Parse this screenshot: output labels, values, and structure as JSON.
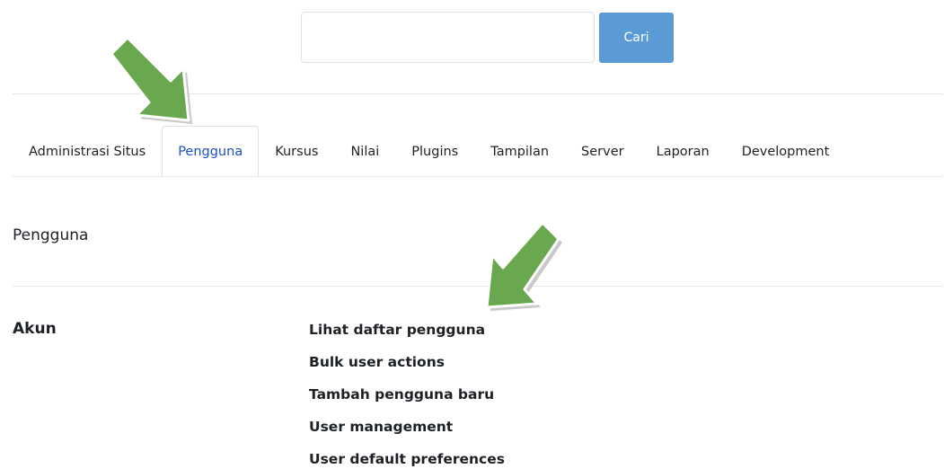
{
  "search": {
    "value": "",
    "placeholder": "",
    "button_label": "Cari"
  },
  "tabs": [
    {
      "label": "Administrasi Situs",
      "active": false
    },
    {
      "label": "Pengguna",
      "active": true
    },
    {
      "label": "Kursus",
      "active": false
    },
    {
      "label": "Nilai",
      "active": false
    },
    {
      "label": "Plugins",
      "active": false
    },
    {
      "label": "Tampilan",
      "active": false
    },
    {
      "label": "Server",
      "active": false
    },
    {
      "label": "Laporan",
      "active": false
    },
    {
      "label": "Development",
      "active": false
    }
  ],
  "section": {
    "title": "Pengguna"
  },
  "category": {
    "title": "Akun",
    "links": [
      "Lihat daftar pengguna",
      "Bulk user actions",
      "Tambah pengguna baru",
      "User management",
      "User default preferences"
    ]
  },
  "colors": {
    "accent": "#1c4fc2",
    "button": "#5b9bd5",
    "arrow": "#6aa84f"
  }
}
